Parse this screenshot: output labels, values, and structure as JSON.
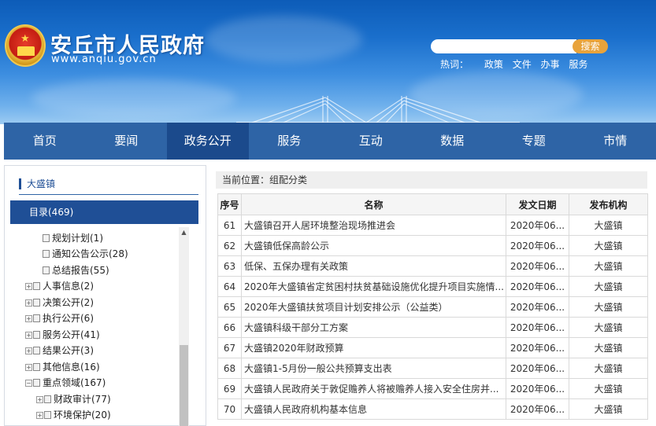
{
  "site": {
    "title": "安丘市人民政府",
    "domain": "www.anqiu.gov.cn"
  },
  "search": {
    "button_label": "搜索",
    "hot_label": "热词：",
    "hot_words": [
      "政策",
      "文件",
      "办事",
      "服务"
    ]
  },
  "nav": {
    "items": [
      "首页",
      "要闻",
      "政务公开",
      "服务",
      "互动",
      "数据",
      "专题",
      "市情"
    ],
    "active_index": 2
  },
  "sidebar": {
    "title": "大盛镇",
    "directory_label": "目录(469)",
    "tree": [
      {
        "label": "规划计划(1)",
        "level": 2,
        "expand": false
      },
      {
        "label": "通知公告公示(28)",
        "level": 2,
        "expand": false
      },
      {
        "label": "总结报告(55)",
        "level": 2,
        "expand": false
      },
      {
        "label": "人事信息(2)",
        "level": 1,
        "expand": true
      },
      {
        "label": "决策公开(2)",
        "level": 1,
        "expand": true
      },
      {
        "label": "执行公开(6)",
        "level": 1,
        "expand": true
      },
      {
        "label": "服务公开(41)",
        "level": 1,
        "expand": true
      },
      {
        "label": "结果公开(3)",
        "level": 1,
        "expand": true
      },
      {
        "label": "其他信息(16)",
        "level": 1,
        "expand": true
      },
      {
        "label": "重点领域(167)",
        "level": 1,
        "expand": true,
        "open": true
      },
      {
        "label": "财政审计(77)",
        "level": 2,
        "expand": true
      },
      {
        "label": "环境保护(20)",
        "level": 2,
        "expand": true
      }
    ]
  },
  "breadcrumb": "当前位置：组配分类",
  "table": {
    "headers": [
      "序号",
      "名称",
      "发文日期",
      "发布机构"
    ],
    "rows": [
      [
        "61",
        "大盛镇召开人居环境整治现场推进会",
        "2020年06...",
        "大盛镇"
      ],
      [
        "62",
        "大盛镇低保高龄公示",
        "2020年06...",
        "大盛镇"
      ],
      [
        "63",
        "低保、五保办理有关政策",
        "2020年06...",
        "大盛镇"
      ],
      [
        "64",
        "2020年大盛镇省定贫困村扶贫基础设施优化提升项目实施情...",
        "2020年06...",
        "大盛镇"
      ],
      [
        "65",
        "2020年大盛镇扶贫项目计划安排公示（公益类）",
        "2020年06...",
        "大盛镇"
      ],
      [
        "66",
        "大盛镇科级干部分工方案",
        "2020年06...",
        "大盛镇"
      ],
      [
        "67",
        "大盛镇2020年财政预算",
        "2020年06...",
        "大盛镇"
      ],
      [
        "68",
        "大盛镇1-5月份一般公共预算支出表",
        "2020年06...",
        "大盛镇"
      ],
      [
        "69",
        "大盛镇人民政府关于敦促赡养人将被赡养人接入安全住房并...",
        "2020年06...",
        "大盛镇"
      ],
      [
        "70",
        "大盛镇人民政府机构基本信息",
        "2020年06...",
        "大盛镇"
      ]
    ]
  }
}
